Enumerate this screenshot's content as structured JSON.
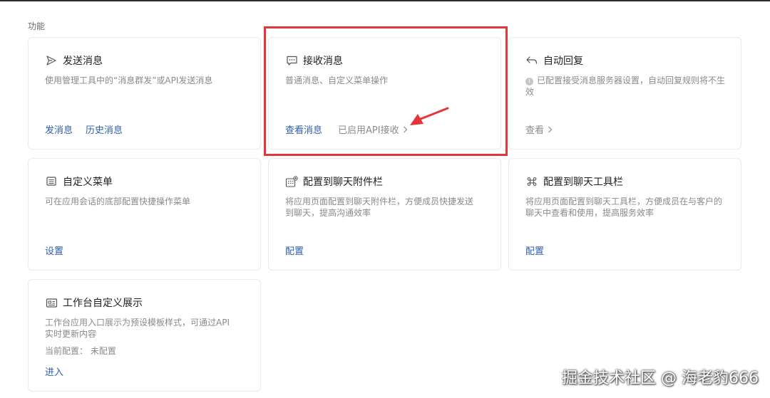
{
  "section_label": "功能",
  "cards": {
    "send": {
      "title": "发送消息",
      "desc": "使用管理工具中的“消息群发”或API发送消息",
      "actions": [
        "发消息",
        "历史消息"
      ]
    },
    "receive": {
      "title": "接收消息",
      "desc": "普通消息、自定义菜单操作",
      "action": "查看消息",
      "status": "已启用API接收"
    },
    "auto_reply": {
      "title": "自动回复",
      "desc": "已配置接受消息服务器设置，自动回复规则将不生效",
      "action": "查看"
    },
    "custom_menu": {
      "title": "自定义菜单",
      "desc": "可在应用会话的底部配置快捷操作菜单",
      "action": "设置"
    },
    "chat_attachment": {
      "title": "配置到聊天附件栏",
      "desc": "将应用页面配置到聊天附件栏，方便成员快捷发送到聊天，提高沟通效率",
      "action": "配置"
    },
    "chat_toolbar": {
      "title": "配置到聊天工具栏",
      "desc": "将应用页面配置到聊天工具栏，方便成员在与客户的聊天中查看和使用，提高服务效率",
      "action": "配置"
    },
    "workbench": {
      "title": "工作台自定义展示",
      "desc": "工作台应用入口展示为预设模板样式，可通过API实时更新内容",
      "config_label": "当前配置：",
      "config_value": "未配置",
      "action": "进入"
    }
  },
  "icons": {
    "send": "send-icon",
    "receive": "message-icon",
    "auto_reply": "reply-icon",
    "custom_menu": "menu-icon",
    "chat_attachment": "attachment-grid-icon",
    "chat_toolbar": "toolbar-icon",
    "workbench": "workbench-card-icon"
  },
  "colors": {
    "link": "#2f5ea8",
    "highlight": "#e5353a",
    "muted": "#8c8c8c"
  },
  "watermark": "掘金技术社区 @ 海老豹666"
}
